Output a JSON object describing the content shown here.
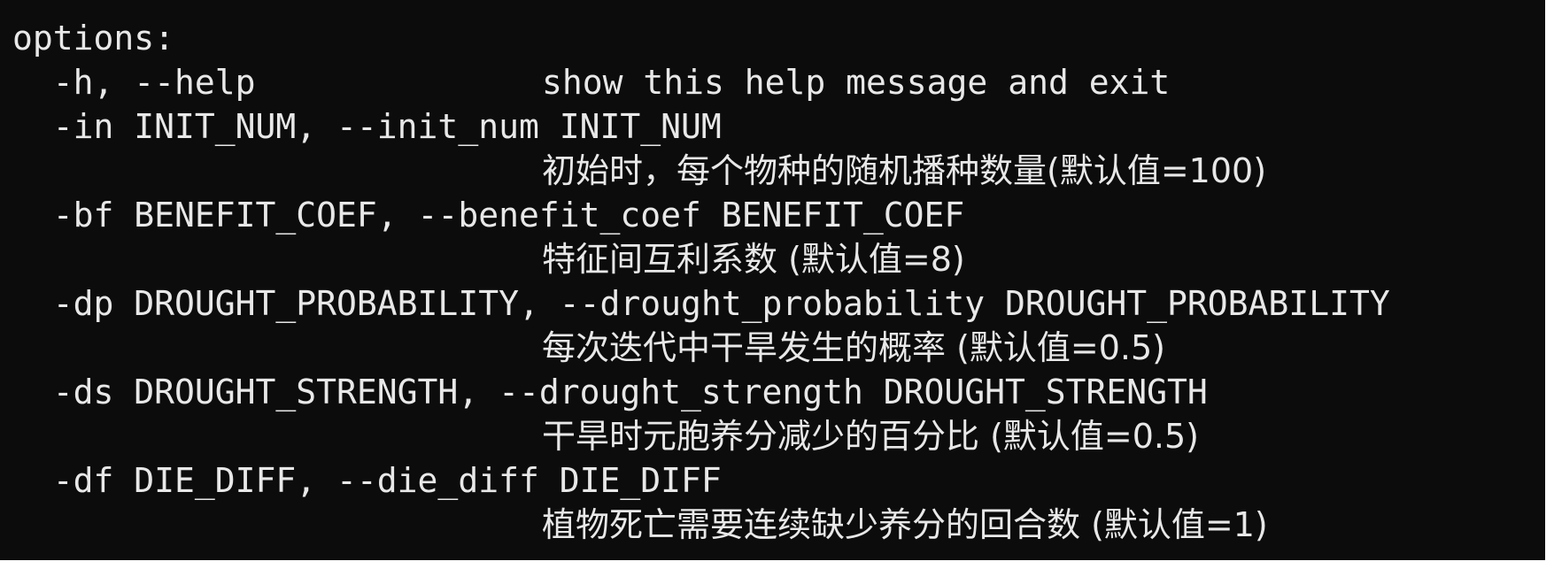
{
  "terminal": {
    "background": "#0c0c0c",
    "foreground": "#e8e8e8",
    "heading": "options:",
    "options": [
      {
        "flags": "  -h, --help",
        "description": "show this help message and exit",
        "inline": true
      },
      {
        "flags": "  -in INIT_NUM, --init_num INIT_NUM",
        "description": "初始时，每个物种的随机播种数量(默认值=100)",
        "inline": false
      },
      {
        "flags": "  -bf BENEFIT_COEF, --benefit_coef BENEFIT_COEF",
        "description": "特征间互利系数 (默认值=8)",
        "inline": false
      },
      {
        "flags": "  -dp DROUGHT_PROBABILITY, --drought_probability DROUGHT_PROBABILITY",
        "description": "每次迭代中干旱发生的概率 (默认值=0.5)",
        "inline": false
      },
      {
        "flags": "  -ds DROUGHT_STRENGTH, --drought_strength DROUGHT_STRENGTH",
        "description": "干旱时元胞养分减少的百分比 (默认值=0.5)",
        "inline": false
      },
      {
        "flags": "  -df DIE_DIFF, --die_diff DIE_DIFF",
        "description": "植物死亡需要连续缺少养分的回合数 (默认值=1)",
        "inline": false
      }
    ]
  }
}
